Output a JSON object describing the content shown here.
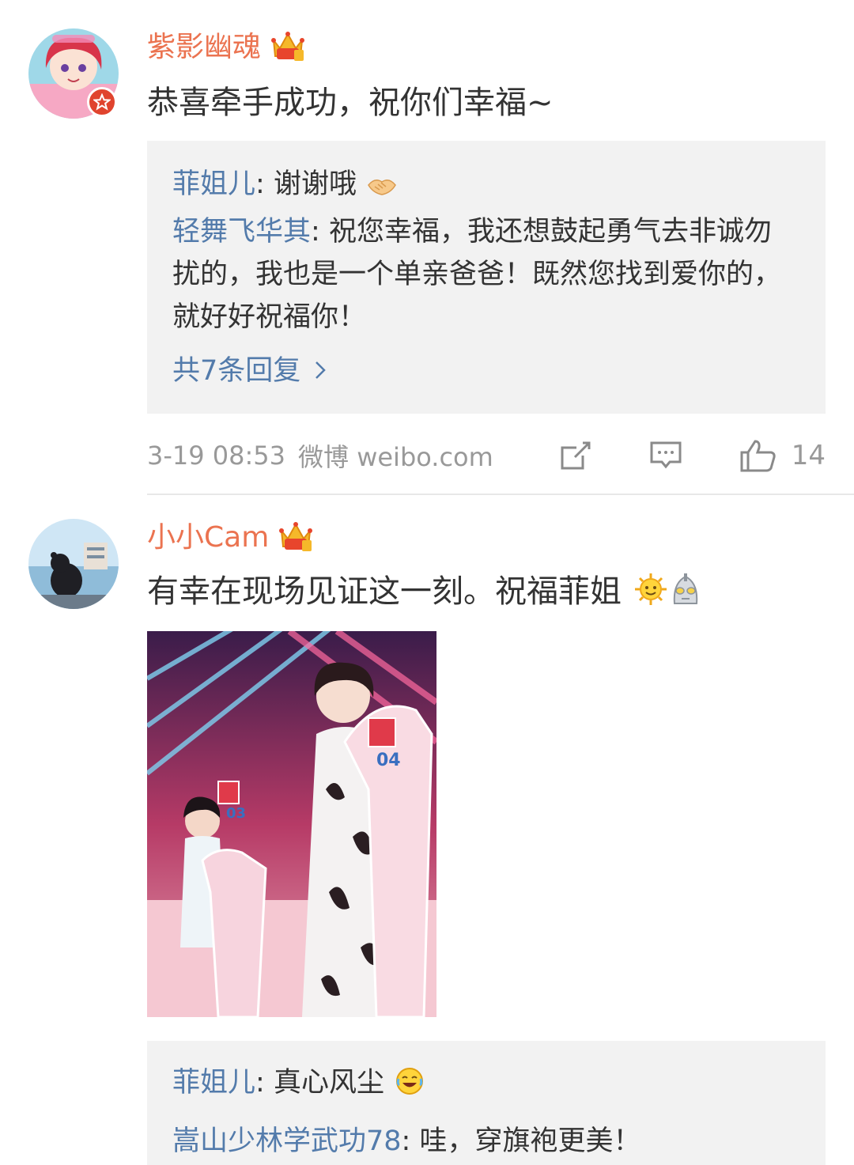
{
  "comments": [
    {
      "username": "紫影幽魂",
      "text": "恭喜牵手成功，祝你们幸福~",
      "replies": [
        {
          "name": "菲姐儿",
          "sep": ":",
          "text": " 谢谢哦"
        },
        {
          "name": "轻舞飞华其",
          "sep": ":",
          "text": " 祝您幸福，我还想鼓起勇气去非诚勿扰的，我也是一个单亲爸爸！既然您找到爱你的，就好好祝福你！"
        }
      ],
      "more_replies": "共7条回复",
      "time": "3-19 08:53",
      "source": "微博 weibo.com",
      "like_count": "14"
    },
    {
      "username": "小小Cam",
      "text": "有幸在现场见证这一刻。祝福菲姐",
      "replies": [
        {
          "name": "菲姐儿",
          "sep": ":",
          "text": " 真心风尘"
        },
        {
          "name": "嵩山少林学武功78",
          "sep": ":",
          "text": " 哇，穿旗袍更美！"
        }
      ],
      "photo_labels": [
        "03",
        "04"
      ]
    }
  ],
  "colors": {
    "username": "#eb7350",
    "link": "#537bab",
    "meta": "#999999",
    "reply_bg": "#f2f2f2"
  },
  "icons": [
    "crown-icon",
    "verified-badge-icon",
    "handshake-emoji-icon",
    "share-icon",
    "comment-icon",
    "like-icon",
    "chevron-right-icon",
    "sun-emoji-icon",
    "robot-emoji-icon",
    "laugh-emoji-icon"
  ]
}
